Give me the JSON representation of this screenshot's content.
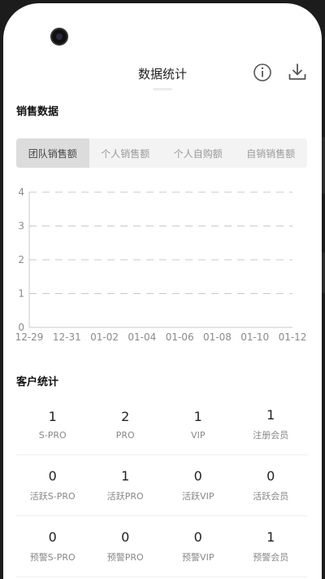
{
  "header": {
    "title": "数据统计",
    "info_icon": "info-circle-icon",
    "download_icon": "download-icon"
  },
  "sales": {
    "title": "销售数据",
    "tabs": [
      {
        "label": "团队销售额",
        "active": true
      },
      {
        "label": "个人销售额",
        "active": false
      },
      {
        "label": "个人自购额",
        "active": false
      },
      {
        "label": "自销销售额",
        "active": false
      }
    ]
  },
  "chart_data": {
    "type": "line",
    "categories": [
      "12-29",
      "12-31",
      "01-02",
      "01-04",
      "01-06",
      "01-08",
      "01-10",
      "01-12"
    ],
    "series": [],
    "y_ticks": [
      "0",
      "1",
      "2",
      "3",
      "4"
    ],
    "ylim": [
      0,
      4
    ],
    "grid": "dashed horizontal",
    "title": "",
    "xlabel": "",
    "ylabel": ""
  },
  "customers": {
    "title": "客户统计",
    "rows": [
      [
        {
          "value": "1",
          "label": "S-PRO"
        },
        {
          "value": "2",
          "label": "PRO"
        },
        {
          "value": "1",
          "label": "VIP"
        },
        {
          "value": "1",
          "label": "注册会员"
        }
      ],
      [
        {
          "value": "0",
          "label": "活跃S-PRO"
        },
        {
          "value": "1",
          "label": "活跃PRO"
        },
        {
          "value": "0",
          "label": "活跃VIP"
        },
        {
          "value": "0",
          "label": "活跃会员"
        }
      ],
      [
        {
          "value": "0",
          "label": "预警S-PRO"
        },
        {
          "value": "0",
          "label": "预警PRO"
        },
        {
          "value": "0",
          "label": "预警VIP"
        },
        {
          "value": "1",
          "label": "预警会员"
        }
      ]
    ]
  },
  "colors": {
    "tab_active_bg": "#dcdcdc",
    "tab_bg": "#f3f3f3",
    "grid_line": "#c8c8c8",
    "axis_text": "#8a8a8a"
  }
}
